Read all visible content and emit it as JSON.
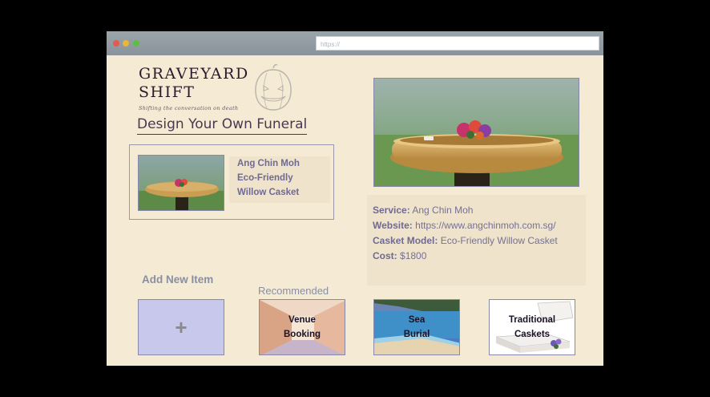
{
  "browser": {
    "url": "https://"
  },
  "brand": {
    "name_line1": "GRAVEYARD",
    "name_line2": "SHIFT",
    "tagline": "Shifting the conversation on death"
  },
  "page": {
    "title": "Design Your Own Funeral"
  },
  "selected_item": {
    "line1": "Ang Chin Moh",
    "line2": "Eco-Friendly",
    "line3": "Willow Casket"
  },
  "details": {
    "service_label": "Service:",
    "service_value": "Ang Chin Moh",
    "website_label": "Website:",
    "website_value": "https://www.angchinmoh.com.sg/",
    "model_label": "Casket Model:",
    "model_value": "Eco-Friendly Willow Casket",
    "cost_label": "Cost:",
    "cost_value": "$1800"
  },
  "add_new": {
    "label": "Add New Item",
    "plus": "+"
  },
  "recommended": {
    "label": "Recommended",
    "items": [
      {
        "line1": "Venue",
        "line2": "Booking"
      },
      {
        "line1": "Sea",
        "line2": "Burial"
      },
      {
        "line1": "Traditional",
        "line2": "Caskets"
      }
    ]
  }
}
